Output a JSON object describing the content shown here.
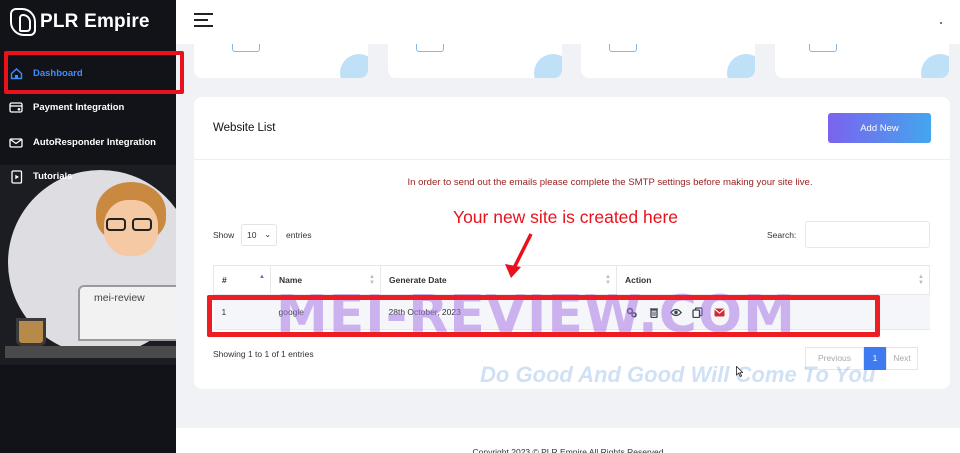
{
  "brand": {
    "logo_text": "PLR Empire"
  },
  "sidebar": {
    "items": [
      {
        "label": "Dashboard",
        "icon": "home-icon",
        "active": true
      },
      {
        "label": "Payment Integration",
        "icon": "payment-icon"
      },
      {
        "label": "AutoResponder Integration",
        "icon": "autoresponder-icon"
      },
      {
        "label": "Tutorials",
        "icon": "tutorials-icon"
      }
    ],
    "illustration_text": "mei-review"
  },
  "panel": {
    "title": "Website List",
    "add_new_label": "Add New",
    "warning": "In order to send out the emails please complete the SMTP settings before making your site live.",
    "show_label": "Show",
    "entries_value": "10",
    "entries_label": "entries",
    "search_label": "Search:"
  },
  "table": {
    "columns": [
      "#",
      "Name",
      "Generate Date",
      "Action"
    ],
    "rows": [
      {
        "num": "1",
        "name": "google",
        "date": "28th October, 2023"
      }
    ],
    "action_icons": [
      "settings-icon",
      "trash-icon",
      "eye-icon",
      "copy-icon",
      "mail-icon"
    ]
  },
  "pagination": {
    "showing": "Showing 1 to 1 of 1 entries",
    "prev": "Previous",
    "current": "1",
    "next": "Next"
  },
  "footer": {
    "text": "Copyright 2023 © PLR Empire All Rights Reserved"
  },
  "annotation": {
    "text": "Your new site is created here"
  },
  "watermark": {
    "main": "MEI-REVIEW.COM",
    "sub": "Do Good And Good Will Come To You"
  },
  "colors": {
    "accent": "#3f8cff",
    "highlight": "#e8111c",
    "warning_text": "#9b2121",
    "sidebar_bg": "#111318"
  }
}
